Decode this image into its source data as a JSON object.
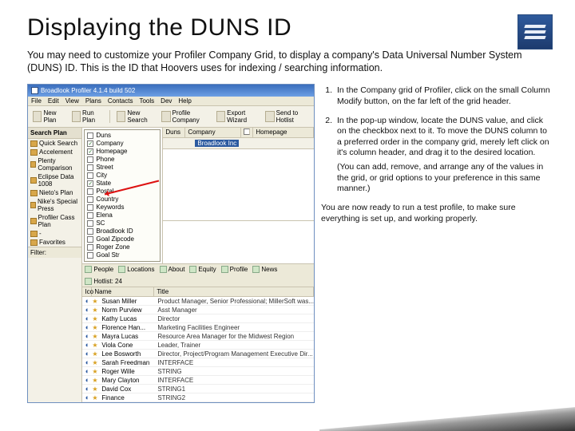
{
  "title": "Displaying the DUNS ID",
  "intro": "You may need to customize your Profiler Company Grid, to display a company's Data Universal Number System (DUNS) ID. This is the ID that Hoovers uses for indexing / searching information.",
  "steps": {
    "item1_num": "1.",
    "item1": "In the Company grid of Profiler, click on the small Column Modify button, on the far left of the grid header.",
    "item2_num": "2.",
    "item2": "In the pop-up window, locate the DUNS value, and click on the checkbox next to it. To move the DUNS column to a preferred order in the company grid, merely left click on it's column header, and drag it to the desired location.",
    "item2_sub": "(You can add, remove, and arrange any of the values in the grid, or grid options to your preference in this same manner.)",
    "closing": "You are now ready to run a test profile, to make sure everything is set up, and working properly."
  },
  "app": {
    "title": "Broadlook Profiler 4.1.4 build 502",
    "menu": [
      "File",
      "Edit",
      "View",
      "Plans",
      "Contacts",
      "Tools",
      "Dev",
      "Help"
    ],
    "toolbar": [
      "New Plan",
      "Run Plan",
      "New Search",
      "Profile Company",
      "Export Wizard",
      "Send to Hotlist"
    ],
    "sidebar_hdr": "Search Plan",
    "sidebar_items": [
      "Quick Search",
      "Accelement",
      "Plenty Comparison",
      "Eclipse Data 1008",
      "Nieto's Plan",
      "Nike's Special Press",
      "Profiler Cass Plan",
      "-",
      "Favorites"
    ],
    "filter_label": "Filter:",
    "grid_cols": {
      "duns": "Duns",
      "company": "Company",
      "homepage": "Homepage"
    },
    "company_cell": "Broadlook Inc",
    "field_panel": [
      {
        "label": "Duns",
        "checked": false
      },
      {
        "label": "Company",
        "checked": true
      },
      {
        "label": "Homepage",
        "checked": true
      },
      {
        "label": "Phone",
        "checked": false
      },
      {
        "label": "Street",
        "checked": false
      },
      {
        "label": "City",
        "checked": false
      },
      {
        "label": "State",
        "checked": true
      },
      {
        "label": "Postal",
        "checked": false
      },
      {
        "label": "Country",
        "checked": false
      },
      {
        "label": "Keywords",
        "checked": false
      },
      {
        "label": "Elena",
        "checked": false
      },
      {
        "label": "SC",
        "checked": false
      },
      {
        "label": "Broadlook ID",
        "checked": false
      },
      {
        "label": "Goal Zipcode",
        "checked": false
      },
      {
        "label": "Roger Zone",
        "checked": false
      },
      {
        "label": "Goal Str",
        "checked": false
      }
    ],
    "tab_icons": [
      "People",
      "Locations",
      "About",
      "Equity",
      "Profile",
      "News",
      "Hotlist: 24"
    ],
    "people_cols": {
      "ico": "Ico",
      "name": "Name",
      "title": "Title"
    },
    "people": [
      {
        "name": "Susan Miller",
        "title": "Product Manager, Senior Professional; MillerSoft was..."
      },
      {
        "name": "Norm Purview",
        "title": "Asst Manager"
      },
      {
        "name": "Kathy Lucas",
        "title": "Director"
      },
      {
        "name": "Florence Han...",
        "title": "Marketing Facilities Engineer"
      },
      {
        "name": "Mayra Lucas",
        "title": "Resource Area Manager for the Midwest Region"
      },
      {
        "name": "Viola Cone",
        "title": "Leader, Trainer"
      },
      {
        "name": "Lee Bosworth",
        "title": "Director, Project/Program Management Executive Dir..."
      },
      {
        "name": "Sarah Freedman",
        "title": "INTERFACE"
      },
      {
        "name": "Roger Wille",
        "title": "STRING"
      },
      {
        "name": "Mary Clayton",
        "title": "INTERFACE"
      },
      {
        "name": "David Cox",
        "title": "STRING1"
      },
      {
        "name": "Finance",
        "title": "STRING2"
      }
    ]
  }
}
